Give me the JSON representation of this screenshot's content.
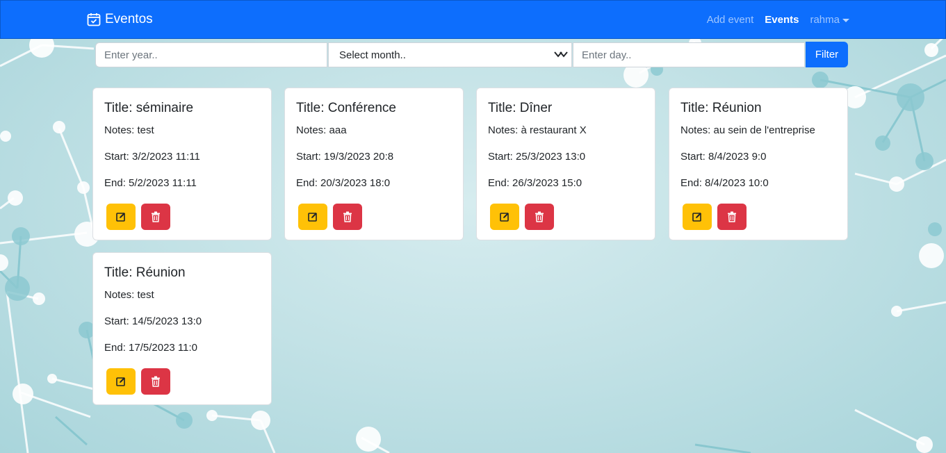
{
  "brand": {
    "title": "Eventos",
    "icon": "calendar-check-icon"
  },
  "nav": {
    "add_event": "Add event",
    "events": "Events",
    "user": "rahma"
  },
  "filter": {
    "year_placeholder": "Enter year..",
    "month_selected": "Select month..",
    "day_placeholder": "Enter day..",
    "button": "Filter"
  },
  "events": [
    {
      "title": "Title: séminaire",
      "notes": "Notes: test",
      "start": "Start: 3/2/2023 11:11",
      "end": "End: 5/2/2023 11:11"
    },
    {
      "title": "Title: Conférence",
      "notes": "Notes: aaa",
      "start": "Start: 19/3/2023 20:8",
      "end": "End: 20/3/2023 18:0"
    },
    {
      "title": "Title: Dîner",
      "notes": "Notes: à restaurant X",
      "start": "Start: 25/3/2023 13:0",
      "end": "End: 26/3/2023 15:0"
    },
    {
      "title": "Title: Réunion",
      "notes": "Notes: au sein de l'entreprise",
      "start": "Start: 8/4/2023 9:0",
      "end": "End: 8/4/2023 10:0"
    },
    {
      "title": "Title: Réunion",
      "notes": "Notes: test",
      "start": "Start: 14/5/2023 13:0",
      "end": "End: 17/5/2023 11:0"
    }
  ],
  "colors": {
    "primary": "#0d6efd",
    "warning": "#ffc107",
    "danger": "#dc3545"
  }
}
